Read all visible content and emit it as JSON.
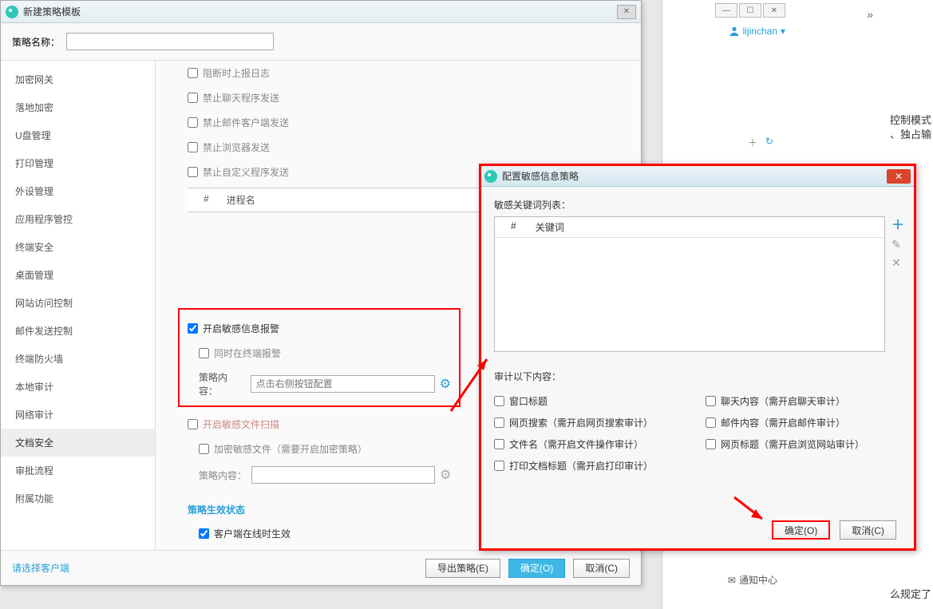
{
  "bg": {
    "username": "lijinchan",
    "notice_center": "通知中心",
    "right_text1": "控制模式",
    "right_text2": "、独占输",
    "right_text3": "么规定了"
  },
  "main": {
    "title": "新建策略模板",
    "name_label": "策略名称：",
    "sidebar": [
      "加密网关",
      "落地加密",
      "U盘管理",
      "打印管理",
      "外设管理",
      "应用程序管控",
      "终端安全",
      "桌面管理",
      "网站访问控制",
      "邮件发送控制",
      "终端防火墙",
      "本地审计",
      "网络审计",
      "文档安全",
      "审批流程",
      "附属功能"
    ],
    "sidebar_active": 13,
    "options": {
      "block_log": "阻断时上报日志",
      "no_chat": "禁止聊天程序发送",
      "no_mail": "禁止邮件客户端发送",
      "no_browser": "禁止浏览器发送",
      "no_custom": "禁止自定义程序发送"
    },
    "proc_table": {
      "col1": "#",
      "col2": "进程名"
    },
    "highlight": {
      "enable_alarm": "开启敏感信息报警",
      "also_terminal": "同时在终端报警",
      "content_label": "策略内容：",
      "content_placeholder": "点击右侧按钮配置"
    },
    "below": {
      "enable_file_scan": "开启敏感文件扫描",
      "encrypt_sensitive": "加密敏感文件（需要开启加密策略）",
      "content_label2": "策略内容："
    },
    "effect_section": "策略生效状态",
    "effect_online": "客户端在线时生效",
    "footer_link": "请选择客户端",
    "btn_export": "导出策略(E)",
    "btn_ok": "确定(O)",
    "btn_cancel": "取消(C)"
  },
  "sub": {
    "title": "配置敏感信息策略",
    "kw_label": "敏感关键词列表：",
    "kw_cols": {
      "c1": "#",
      "c2": "关键词"
    },
    "audit_label": "审计以下内容：",
    "audit_items": [
      "窗口标题",
      "聊天内容（需开启聊天审计）",
      "网页搜索（需开启网页搜索审计）",
      "邮件内容（需开启邮件审计）",
      "文件名（需开启文件操作审计）",
      "网页标题（需开启浏览网站审计）",
      "打印文档标题（需开启打印审计）"
    ],
    "btn_ok": "确定(O)",
    "btn_cancel": "取消(C)"
  }
}
